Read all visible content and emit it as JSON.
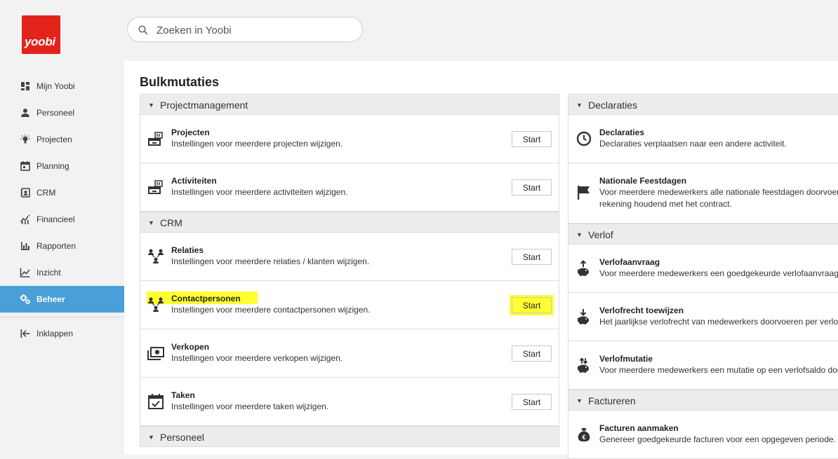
{
  "app": {
    "logo_text": "yoobi",
    "brand_color": "#e2231a",
    "accent_color": "#4a9fd8",
    "highlight_color": "#ffff33"
  },
  "search": {
    "placeholder": "Zoeken in Yoobi"
  },
  "sidebar": {
    "items": [
      {
        "label": "Mijn Yoobi",
        "icon": "dashboard-icon"
      },
      {
        "label": "Personeel",
        "icon": "person-icon"
      },
      {
        "label": "Projecten",
        "icon": "lightbulb-icon"
      },
      {
        "label": "Planning",
        "icon": "calendar-icon"
      },
      {
        "label": "CRM",
        "icon": "contacts-icon"
      },
      {
        "label": "Financieel",
        "icon": "finance-chart-icon"
      },
      {
        "label": "Rapporten",
        "icon": "bar-chart-icon"
      },
      {
        "label": "Inzicht",
        "icon": "line-chart-icon"
      },
      {
        "label": "Beheer",
        "icon": "gears-icon",
        "active": true
      }
    ],
    "collapse_label": "Inklappen"
  },
  "page": {
    "title": "Bulkmutaties",
    "start_label": "Start"
  },
  "left_sections": [
    {
      "title": "Projectmanagement",
      "rows": [
        {
          "title": "Projecten",
          "desc": "Instellingen voor meerdere projecten wijzigen.",
          "icon": "project-icon"
        },
        {
          "title": "Activiteiten",
          "desc": "Instellingen voor meerdere activiteiten wijzigen.",
          "icon": "activity-icon"
        }
      ]
    },
    {
      "title": "CRM",
      "rows": [
        {
          "title": "Relaties",
          "desc": "Instellingen voor meerdere relaties / klanten wijzigen.",
          "icon": "relations-icon"
        },
        {
          "title": "Contactpersonen",
          "desc": "Instellingen voor meerdere contactpersonen wijzigen.",
          "icon": "contacts-group-icon",
          "highlighted": true
        },
        {
          "title": "Verkopen",
          "desc": "Instellingen voor meerdere verkopen wijzigen.",
          "icon": "money-icon"
        },
        {
          "title": "Taken",
          "desc": "Instellingen voor meerdere taken wijzigen.",
          "icon": "task-calendar-icon"
        }
      ]
    },
    {
      "title": "Personeel",
      "rows": []
    }
  ],
  "right_sections": [
    {
      "title": "Declaraties",
      "rows": [
        {
          "title": "Declaraties",
          "desc": "Declaraties verplaatsen naar een andere activiteit.",
          "icon": "clock-icon"
        },
        {
          "title": "Nationale Feestdagen",
          "desc": "Voor meerdere medewerkers alle nationale feestdagen doorvoeren rekening houdend met het contract.",
          "icon": "flag-icon"
        }
      ]
    },
    {
      "title": "Verlof",
      "rows": [
        {
          "title": "Verlofaanvraag",
          "desc": "Voor meerdere medewerkers een goedgekeurde verlofaanvraag i",
          "icon": "piggybank-up-icon"
        },
        {
          "title": "Verlofrecht toewijzen",
          "desc": "Het jaarlijkse verlofrecht van medewerkers doorvoeren per verlof",
          "icon": "piggybank-down-icon"
        },
        {
          "title": "Verlofmutatie",
          "desc": "Voor meerdere medewerkers een mutatie op een verlofsaldo doo",
          "icon": "piggybank-swap-icon"
        }
      ]
    },
    {
      "title": "Factureren",
      "rows": [
        {
          "title": "Facturen aanmaken",
          "desc": "Genereer goedgekeurde facturen voor een opgegeven periode.",
          "icon": "money-bag-icon"
        }
      ]
    }
  ]
}
